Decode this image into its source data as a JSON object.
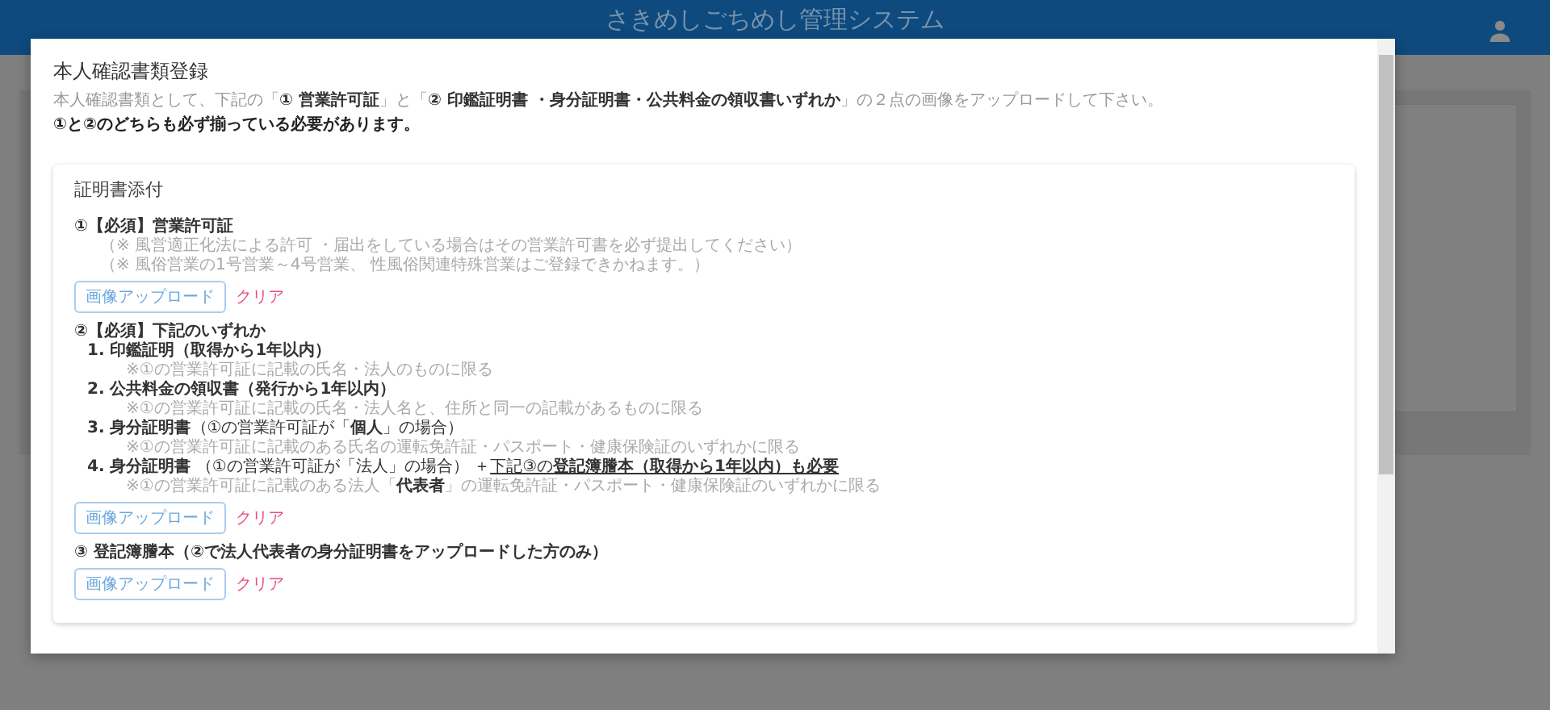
{
  "header": {
    "title": "さきめしごちめし管理システム"
  },
  "dialog": {
    "title": "本人確認書類登録",
    "description": "本人確認書類として、下記の「**① 営業許可証**」と「**② 印鑑証明書 ・身分証明書・公共料金の領収書いずれか**」の２点の画像をアップロードして下さい。",
    "requirement": "①と②のどちらも必ず揃っている必要があります。",
    "card": {
      "title": "証明書添付",
      "sections": [
        {
          "heading": "①【必須】営業許可証",
          "notes": [
            "（※ 風営適正化法による許可 ・届出をしている場合はその営業許可書を必ず提出してください）",
            "（※ 風俗営業の1号営業～4号営業、 性風俗関連特殊営業はご登録できかねます。）"
          ],
          "upload_button": "画像アップロード",
          "clear_link": "クリア"
        },
        {
          "heading": "②【必須】下記のいずれか",
          "items": [
            {
              "label": "**1. 印鑑証明（取得から1年以内）**",
              "note": "※①の営業許可証に記載の氏名・法人のものに限る"
            },
            {
              "label": "**2. 公共料金の領収書（発行から1年以内）**",
              "note": "※①の営業許可証に記載の氏名・法人名と、住所と同一の記載があるものに限る"
            },
            {
              "label": "**3. 身分証明書**（①の営業許可証が「**個人**」の場合）",
              "note": "※①の営業許可証に記載のある氏名の運転免許証・パスポート・健康保険証のいずれかに限る"
            },
            {
              "label": "**4. 身分証明書** （①の営業許可証が「法人」の場合） ＋",
              "extra": "下記③の**登記簿謄本（取得から1年以内）も必要**",
              "note": "※①の営業許可証に記載のある法人「**代表者**」の運転免許証・パスポート・健康保険証のいずれかに限る"
            }
          ],
          "upload_button": "画像アップロード",
          "clear_link": "クリア"
        },
        {
          "heading": "③ 登記簿謄本（②で法人代表者の身分証明書をアップロードした方のみ）",
          "upload_button": "画像アップロード",
          "clear_link": "クリア"
        }
      ]
    }
  }
}
